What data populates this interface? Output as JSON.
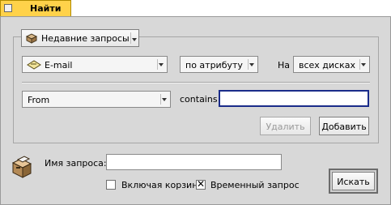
{
  "window": {
    "tab_title": "Найти"
  },
  "recent_queries": {
    "label": "Недавние запросы",
    "icon": "package-icon"
  },
  "criteria": {
    "type_value": "E-mail",
    "type_icon": "envelope-icon",
    "match_mode": "по атрибуту",
    "on_label": "На",
    "volume": "всех дисках"
  },
  "attribute_row": {
    "attribute": "From",
    "operator": "contains",
    "value": ""
  },
  "buttons": {
    "remove": "Удалить",
    "add": "Добавить",
    "search": "Искать"
  },
  "query": {
    "name_label": "Имя запроса:",
    "name_value": "",
    "include_trash_label": "Включая корзину",
    "include_trash_checked": false,
    "temporary_label": "Временный запрос",
    "temporary_checked": true,
    "temporary_mark": "✕",
    "icon": "file-cabinet-icon"
  },
  "colors": {
    "tab_accent": "#ffd24a",
    "window_bg": "#d8d8d8",
    "focus_border": "#1a2c8a"
  }
}
